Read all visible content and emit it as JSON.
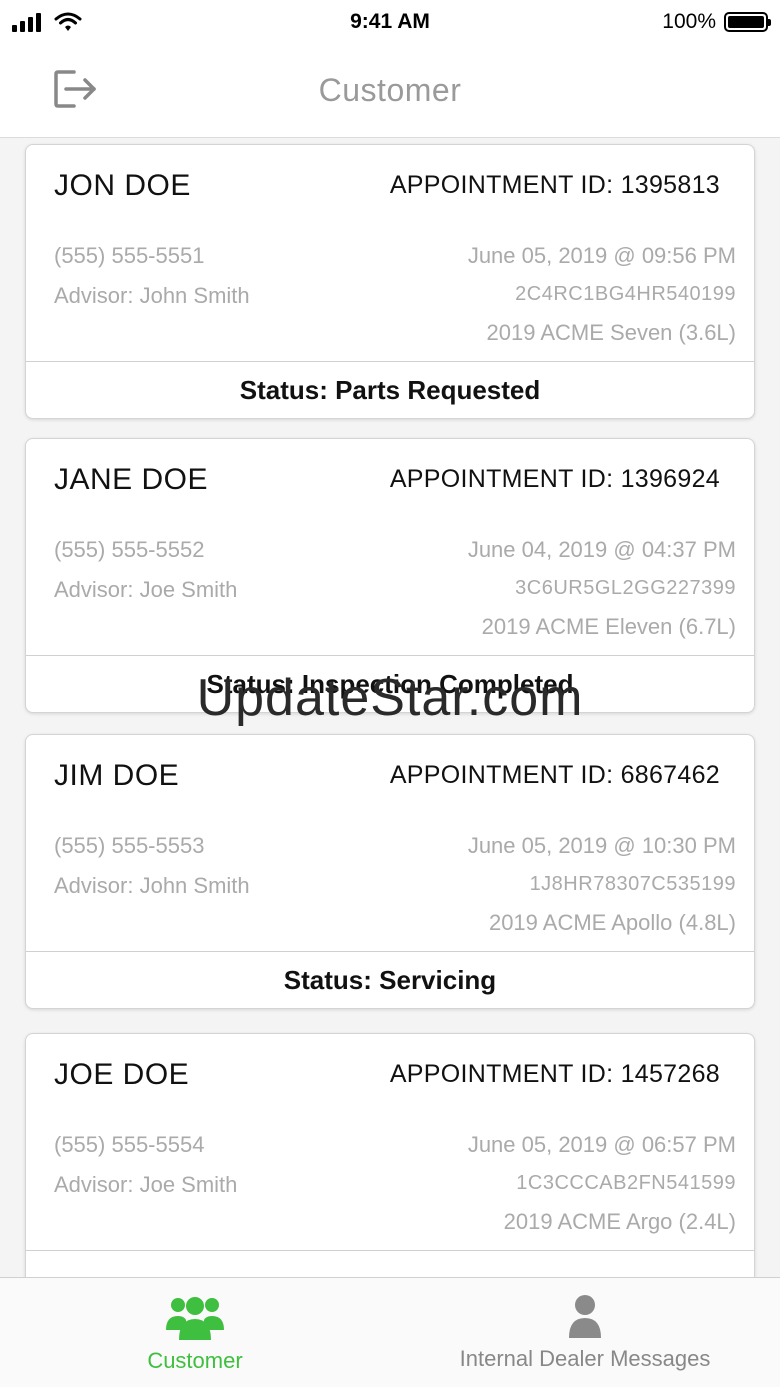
{
  "status_bar": {
    "time": "9:41 AM",
    "battery": "100%"
  },
  "header": {
    "title": "Customer",
    "logout_icon": "logout-icon"
  },
  "appointments": [
    {
      "name": "JON DOE",
      "appointment_id": "APPOINTMENT ID: 1395813",
      "phone": "(555) 555-5551",
      "advisor": "Advisor: John Smith",
      "date": "June 05, 2019 @ 09:56 PM",
      "vin": "2C4RC1BG4HR540199",
      "vehicle": "2019 ACME Seven (3.6L)",
      "status": "Status: Parts Requested"
    },
    {
      "name": "JANE DOE",
      "appointment_id": "APPOINTMENT ID: 1396924",
      "phone": "(555) 555-5552",
      "advisor": "Advisor: Joe Smith",
      "date": "June 04, 2019 @ 04:37 PM",
      "vin": "3C6UR5GL2GG227399",
      "vehicle": "2019 ACME Eleven (6.7L)",
      "status": "Status: Inspection Completed"
    },
    {
      "name": "JIM DOE",
      "appointment_id": "APPOINTMENT ID: 6867462",
      "phone": "(555) 555-5553",
      "advisor": "Advisor: John Smith",
      "date": "June 05, 2019 @ 10:30 PM",
      "vin": "1J8HR78307C535199",
      "vehicle": "2019 ACME Apollo (4.8L)",
      "status": "Status: Servicing"
    },
    {
      "name": "JOE DOE",
      "appointment_id": "APPOINTMENT ID: 1457268",
      "phone": "(555) 555-5554",
      "advisor": "Advisor: Joe Smith",
      "date": "June 05, 2019 @ 06:57 PM",
      "vin": "1C3CCCAB2FN541599",
      "vehicle": "2019 ACME Argo (2.4L)",
      "status": ""
    }
  ],
  "watermark": "UpdateStar.com",
  "tabs": [
    {
      "label": "Customer",
      "icon": "users-icon",
      "active": true
    },
    {
      "label": "Internal Dealer Messages",
      "icon": "person-icon",
      "active": false
    }
  ],
  "colors": {
    "accent": "#3fbf3f",
    "inactive": "#888888",
    "muted_text": "#aaaaaa"
  }
}
